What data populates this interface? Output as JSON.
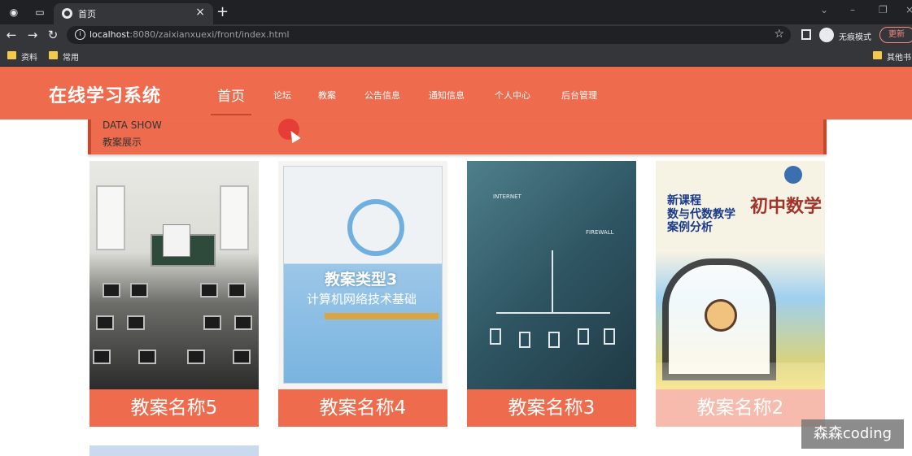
{
  "browser": {
    "tab_title": "首页",
    "url_host": "localhost",
    "url_path": ":8080/zaixianxuexi/front/index.html",
    "incognito_label": "无痕模式",
    "update_label": "更新",
    "bookmarks": [
      "资料",
      "常用"
    ],
    "other_bookmarks": "其他书"
  },
  "site": {
    "logo": "在线学习系统",
    "nav": [
      "首页",
      "论坛",
      "教案",
      "公告信息",
      "通知信息",
      "个人中心",
      "后台管理"
    ],
    "active_index": 0,
    "accent_color": "#ee6b4d"
  },
  "banner": {
    "en": "DATA SHOW",
    "zh": "教案展示"
  },
  "cards": [
    {
      "caption": "教案名称5",
      "image": "classroom-photo"
    },
    {
      "caption": "教案名称4",
      "image": "book-cover",
      "book_title": "教案类型3",
      "book_subtitle": "计算机网络技术基础"
    },
    {
      "caption": "教案名称3",
      "image": "network-diagram-photo",
      "label1": "INTERNET",
      "label2": "FIREWALL"
    },
    {
      "caption": "教案名称2",
      "image": "math-book-cover",
      "book_title": "初中数学",
      "book_line1": "新课程",
      "book_line2": "数与代数教学",
      "book_line3": "案例分析"
    }
  ],
  "watermark": "森森coding"
}
